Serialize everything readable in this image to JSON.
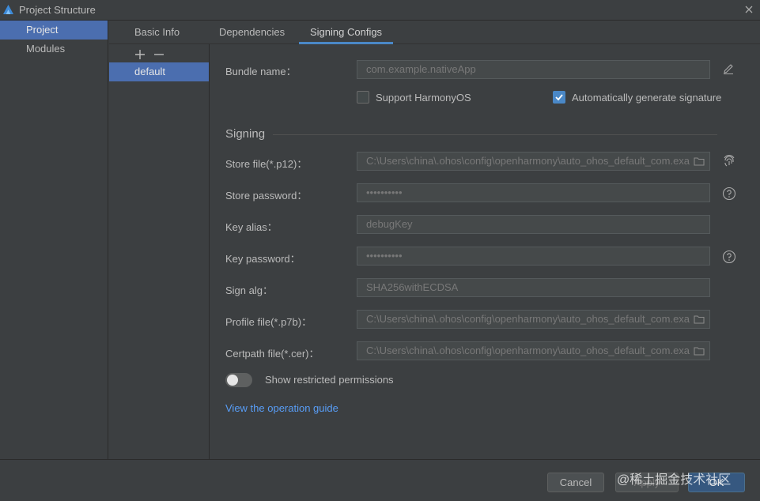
{
  "window": {
    "title": "Project Structure",
    "logo_icon": "harmony-logo-icon",
    "close_icon": "close-icon"
  },
  "nav": {
    "items": [
      {
        "label": "Project",
        "active": true
      },
      {
        "label": "Modules",
        "active": false
      }
    ]
  },
  "tabs": [
    {
      "label": "Basic Info",
      "active": false
    },
    {
      "label": "Dependencies",
      "active": false
    },
    {
      "label": "Signing Configs",
      "active": true
    }
  ],
  "configs": {
    "add_icon": "plus-icon",
    "remove_icon": "minus-icon",
    "items": [
      {
        "label": "default",
        "selected": true
      }
    ]
  },
  "form": {
    "bundle_name": {
      "label": "Bundle name：",
      "value": "com.example.nativeApp",
      "edit_icon": "pencil-icon"
    },
    "support_harmonyos": {
      "label": "Support HarmonyOS",
      "checked": false
    },
    "auto_sign": {
      "label": "Automatically generate signature",
      "checked": true
    },
    "signing_title": "Signing",
    "store_file": {
      "label": "Store file(*.p12)：",
      "value": "C:\\Users\\china\\.ohos\\config\\openharmony\\auto_ohos_default_com.exa",
      "side_icon": "fingerprint-icon"
    },
    "store_password": {
      "label": "Store password：",
      "value": "••••••••••",
      "side_icon": "help-icon"
    },
    "key_alias": {
      "label": "Key alias：",
      "value": "debugKey"
    },
    "key_password": {
      "label": "Key password：",
      "value": "••••••••••",
      "side_icon": "help-icon"
    },
    "sign_alg": {
      "label": "Sign alg：",
      "value": "SHA256withECDSA"
    },
    "profile_file": {
      "label": "Profile file(*.p7b)：",
      "value": "C:\\Users\\china\\.ohos\\config\\openharmony\\auto_ohos_default_com.exa"
    },
    "certpath_file": {
      "label": "Certpath file(*.cer)：",
      "value": "C:\\Users\\china\\.ohos\\config\\openharmony\\auto_ohos_default_com.exa"
    },
    "show_restricted": {
      "label": "Show restricted permissions",
      "on": false
    },
    "guide_link": "View the operation guide"
  },
  "footer": {
    "cancel": "Cancel",
    "apply": "Apply",
    "ok": "OK",
    "watermark": "@稀土掘金技术社区"
  },
  "colors": {
    "accent": "#4b6eaf",
    "link": "#589df6",
    "ok_button": "#365880",
    "background": "#3c3f41"
  }
}
